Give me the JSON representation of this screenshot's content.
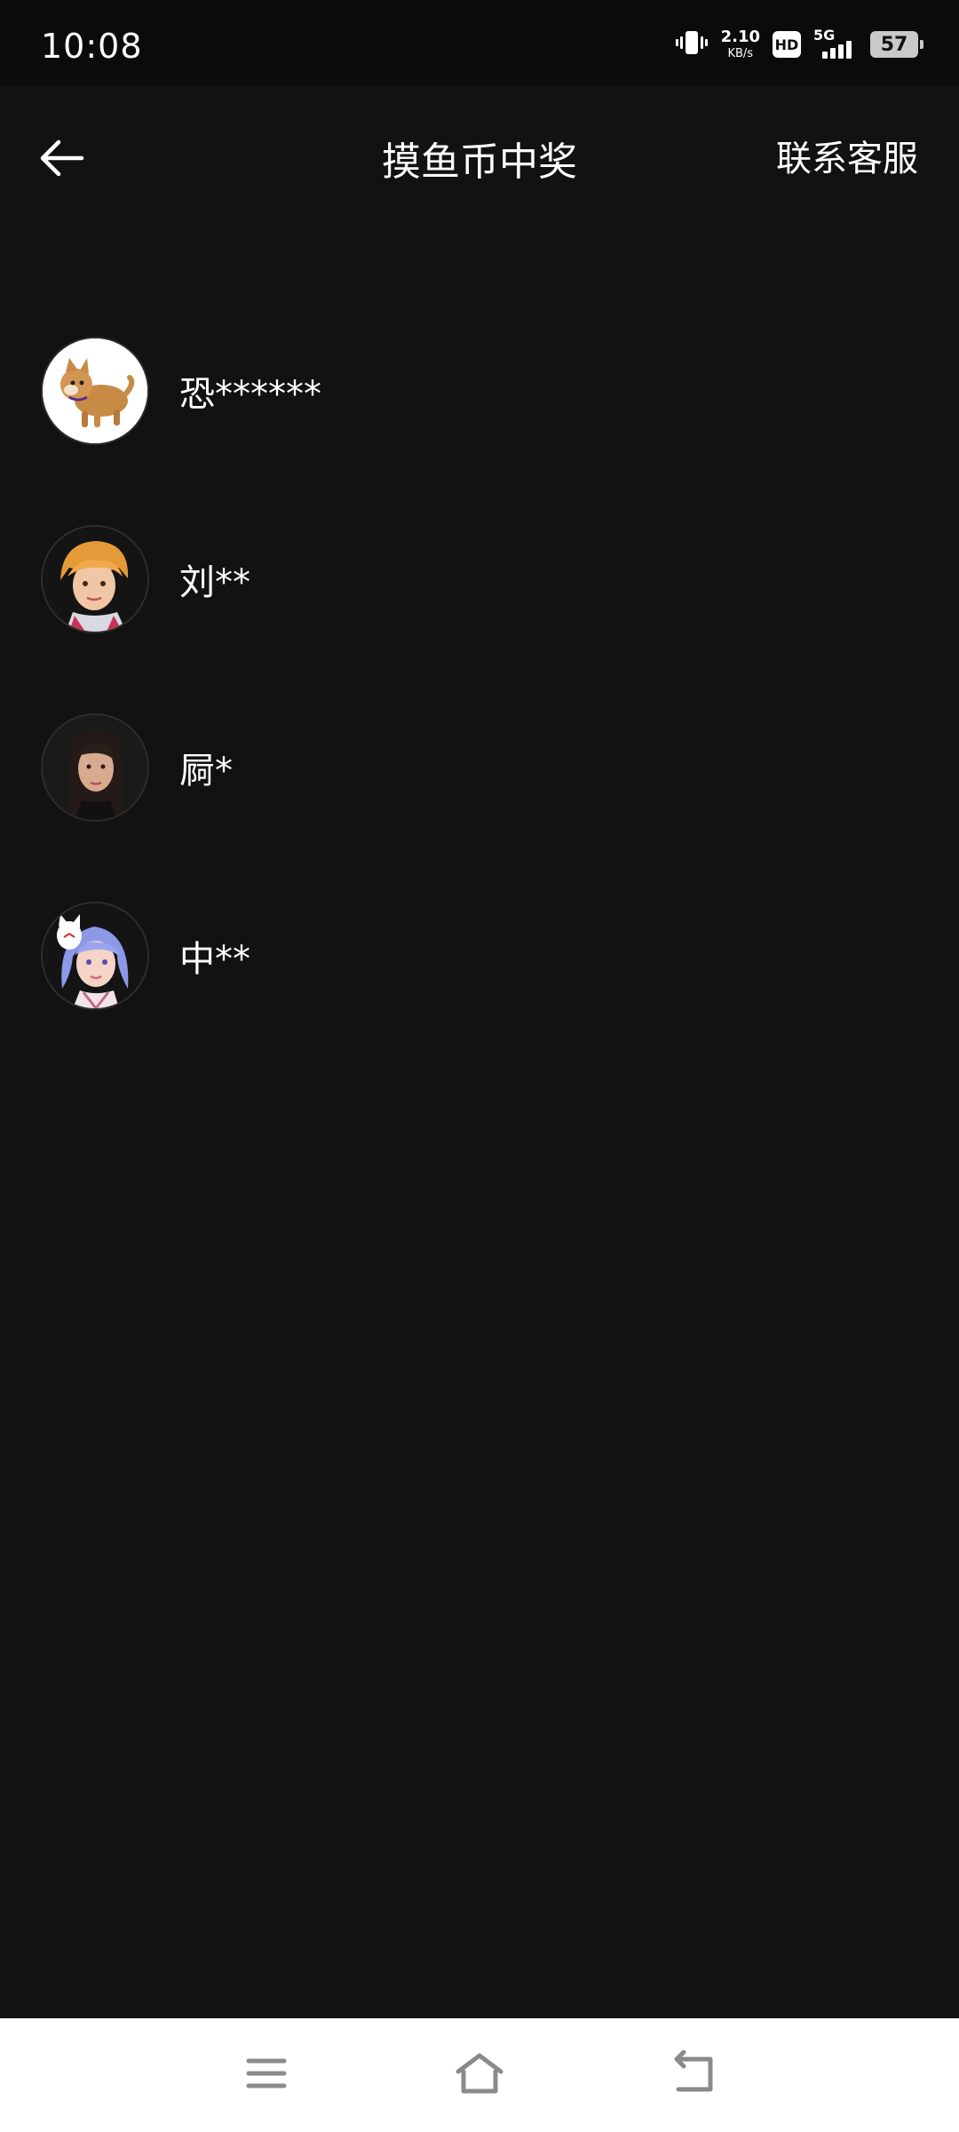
{
  "status_bar": {
    "time": "10:08",
    "net_speed_value": "2.10",
    "net_speed_unit": "KB/s",
    "hd_label": "HD",
    "network_type": "5G",
    "battery_level": "57",
    "icons": [
      "vibrate-icon",
      "hd-icon",
      "signal-icon",
      "battery-icon"
    ]
  },
  "header": {
    "back_icon": "arrow-left-icon",
    "title": "摸鱼币中奖",
    "support_label": "联系客服"
  },
  "winners": [
    {
      "name": "恐******",
      "avatar": "shiba-dog-avatar"
    },
    {
      "name": "刘**",
      "avatar": "orange-hair-character-avatar"
    },
    {
      "name": "屙*",
      "avatar": "dark-hair-woman-avatar"
    },
    {
      "name": "中**",
      "avatar": "blue-hair-fox-mask-avatar"
    }
  ],
  "nav_bar": {
    "icons": [
      "menu-icon",
      "home-icon",
      "back-icon"
    ]
  },
  "colors": {
    "background": "#121212",
    "status_bar": "#0b0b0b",
    "text": "#ffffff",
    "nav_bar": "#ffffff",
    "nav_icon": "#8a8a8a"
  }
}
